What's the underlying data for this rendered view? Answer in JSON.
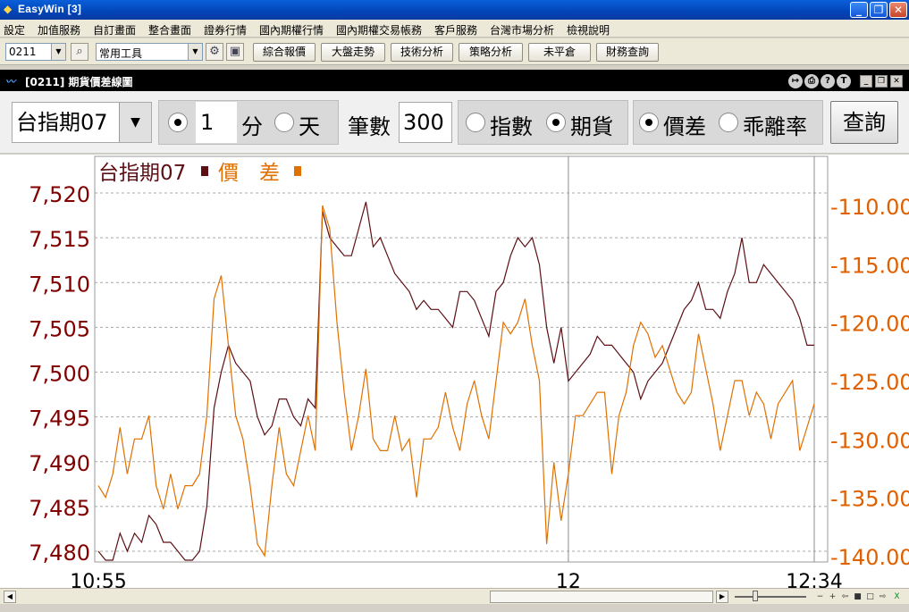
{
  "window": {
    "title": "EasyWin [3]",
    "app_icon": "easywin-logo-icon",
    "buttons": [
      "_",
      "❐",
      "✕"
    ]
  },
  "menu": {
    "items": [
      "設定",
      "加值服務",
      "自訂畫面",
      "整合畫面",
      "證券行情",
      "國內期權行情",
      "國內期權交易帳務",
      "客戶服務",
      "台灣市場分析",
      "檢視說明"
    ]
  },
  "toolbar": {
    "code_value": "0211",
    "tool_value": "常用工具",
    "buttons": [
      "綜合報價",
      "大盤走勢",
      "技術分析",
      "策略分析",
      "未平倉",
      "財務查詢"
    ]
  },
  "inner_window": {
    "title": "[0211] 期貨價差線圖"
  },
  "controls": {
    "product": "台指期07",
    "period_value": "1",
    "unit_minute": "分",
    "unit_day": "天",
    "count_label": "筆數",
    "count_value": "300",
    "source_index": "指數",
    "source_futures": "期貨",
    "mode_spread": "價差",
    "mode_deviation": "乖離率",
    "query_button": "查詢",
    "selected": {
      "unit": "分",
      "source": "期貨",
      "mode": "價差"
    }
  },
  "chart_data": {
    "type": "line",
    "x_tick_labels": [
      "10:55",
      "12",
      "12:34"
    ],
    "x": [
      "10:55",
      "10:56",
      "10:57",
      "10:58",
      "10:59",
      "11:00",
      "11:01",
      "11:02",
      "11:03",
      "11:04",
      "11:05",
      "11:06",
      "11:07",
      "11:08",
      "11:09",
      "11:10",
      "11:11",
      "11:12",
      "11:13",
      "11:14",
      "11:15",
      "11:16",
      "11:17",
      "11:18",
      "11:19",
      "11:20",
      "11:21",
      "11:22",
      "11:23",
      "11:24",
      "11:25",
      "11:26",
      "11:27",
      "11:28",
      "11:29",
      "11:30",
      "11:31",
      "11:32",
      "11:33",
      "11:34",
      "11:35",
      "11:36",
      "11:37",
      "11:38",
      "11:39",
      "11:40",
      "11:41",
      "11:42",
      "11:43",
      "11:44",
      "11:45",
      "11:46",
      "11:47",
      "11:48",
      "11:49",
      "11:50",
      "11:51",
      "11:52",
      "11:53",
      "11:54",
      "11:55",
      "11:56",
      "11:57",
      "11:58",
      "11:59",
      "12:00",
      "12:01",
      "12:02",
      "12:03",
      "12:04",
      "12:05",
      "12:06",
      "12:07",
      "12:08",
      "12:09",
      "12:10",
      "12:11",
      "12:12",
      "12:13",
      "12:14",
      "12:15",
      "12:16",
      "12:17",
      "12:18",
      "12:19",
      "12:20",
      "12:21",
      "12:22",
      "12:23",
      "12:24",
      "12:25",
      "12:26",
      "12:27",
      "12:28",
      "12:29",
      "12:30",
      "12:31",
      "12:32",
      "12:33",
      "12:34"
    ],
    "series": [
      {
        "name": "台指期07",
        "axis": "left",
        "color": "#5c0f14",
        "values": [
          7480,
          7479,
          7479,
          7482,
          7480,
          7482,
          7481,
          7484,
          7483,
          7481,
          7481,
          7480,
          7479,
          7479,
          7480,
          7485,
          7496,
          7500,
          7503,
          7501,
          7500,
          7499,
          7495,
          7493,
          7494,
          7497,
          7497,
          7495,
          7494,
          7497,
          7496,
          7518,
          7515,
          7514,
          7513,
          7513,
          7516,
          7519,
          7514,
          7515,
          7513,
          7511,
          7510,
          7509,
          7507,
          7508,
          7507,
          7507,
          7506,
          7505,
          7509,
          7509,
          7508,
          7506,
          7504,
          7509,
          7510,
          7513,
          7515,
          7514,
          7515,
          7512,
          7505,
          7501,
          7505,
          7499,
          7500,
          7501,
          7502,
          7504,
          7503,
          7503,
          7502,
          7501,
          7500,
          7497,
          7499,
          7500,
          7501,
          7503,
          7505,
          7507,
          7508,
          7510,
          7507,
          7507,
          7506,
          7509,
          7511,
          7515,
          7510,
          7510,
          7512,
          7511,
          7510,
          7509,
          7508,
          7506,
          7503,
          7503
        ]
      },
      {
        "name": "價差",
        "axis": "right",
        "color": "#e07000",
        "values": [
          -134.0,
          -135.0,
          -133.0,
          -129.0,
          -133.0,
          -130.0,
          -130.0,
          -128.0,
          -134.0,
          -136.0,
          -133.0,
          -136.0,
          -134.0,
          -134.0,
          -133.0,
          -128.0,
          -118.0,
          -116.0,
          -122.0,
          -128.0,
          -130.0,
          -134.0,
          -139.0,
          -140.0,
          -134.0,
          -129.0,
          -133.0,
          -134.0,
          -131.0,
          -128.0,
          -131.0,
          -110.0,
          -112.0,
          -120.0,
          -126.0,
          -131.0,
          -128.0,
          -124.0,
          -130.0,
          -131.0,
          -131.0,
          -128.0,
          -131.0,
          -130.0,
          -135.0,
          -130.0,
          -130.0,
          -129.0,
          -126.0,
          -129.0,
          -131.0,
          -127.0,
          -125.0,
          -128.0,
          -130.0,
          -125.0,
          -120.0,
          -121.0,
          -120.0,
          -118.0,
          -122.0,
          -125.0,
          -139.0,
          -132.0,
          -137.0,
          -133.0,
          -128.0,
          -128.0,
          -127.0,
          -126.0,
          -126.0,
          -133.0,
          -128.0,
          -126.0,
          -122.0,
          -120.0,
          -121.0,
          -123.0,
          -122.0,
          -124.0,
          -126.0,
          -127.0,
          -126.0,
          -121.0,
          -124.0,
          -127.0,
          -131.0,
          -128.0,
          -125.0,
          -125.0,
          -128.0,
          -126.0,
          -127.0,
          -130.0,
          -127.0,
          -126.0,
          -125.0,
          -131.0,
          -129.0,
          -127.0
        ]
      }
    ],
    "legend": [
      "台指期07",
      "價差"
    ],
    "legend_label_spread": "價　差",
    "legend_position": "top-left",
    "y_left_ticks": [
      "7,520",
      "7,515",
      "7,510",
      "7,505",
      "7,500",
      "7,495",
      "7,490",
      "7,485",
      "7,480"
    ],
    "y_left_values": [
      7520,
      7515,
      7510,
      7505,
      7500,
      7495,
      7490,
      7485,
      7480
    ],
    "y_right_ticks": [
      "-110.00",
      "-115.00",
      "-120.00",
      "-125.00",
      "-130.00",
      "-135.00",
      "-140.00"
    ],
    "y_right_values": [
      -110,
      -115,
      -120,
      -125,
      -130,
      -135,
      -140
    ],
    "ylim_left": [
      7479,
      7521
    ],
    "ylim_right": [
      -140,
      -110
    ],
    "grid": true,
    "tick_color_left": "#800000",
    "tick_color_right": "#e06000"
  }
}
